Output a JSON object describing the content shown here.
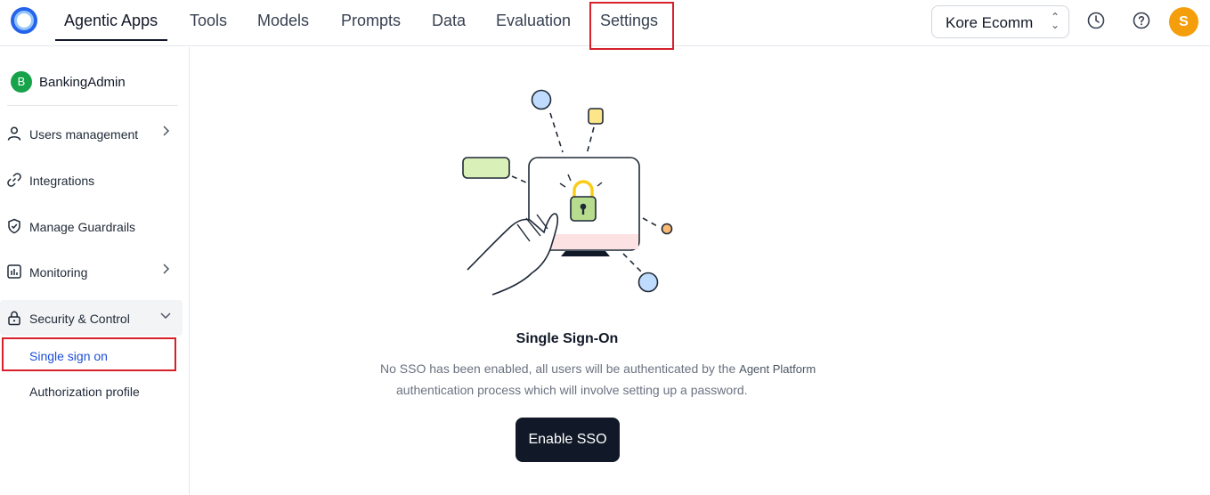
{
  "nav": {
    "tabs": [
      {
        "label": "Agentic Apps",
        "active": true
      },
      {
        "label": "Tools"
      },
      {
        "label": "Models"
      },
      {
        "label": "Prompts"
      },
      {
        "label": "Data"
      },
      {
        "label": "Evaluation"
      },
      {
        "label": "Settings",
        "highlighted": true
      }
    ],
    "workspace": "Kore Ecomm",
    "avatar_initial": "S"
  },
  "sidebar": {
    "org_initial": "B",
    "org_name": "BankingAdmin",
    "items": [
      {
        "label": "Users management",
        "icon": "user-icon",
        "has_chevron": true
      },
      {
        "label": "Integrations",
        "icon": "link-icon"
      },
      {
        "label": "Manage Guardrails",
        "icon": "shield-icon"
      },
      {
        "label": "Monitoring",
        "icon": "chart-icon",
        "has_chevron": true
      },
      {
        "label": "Security & Control",
        "icon": "lock-icon",
        "expanded": true
      }
    ],
    "sub_items": [
      {
        "label": "Single sign on",
        "active": true,
        "highlighted": true
      },
      {
        "label": "Authorization profile"
      }
    ]
  },
  "main": {
    "title": "Single Sign-On",
    "description_line1": "No SSO has been enabled, all users will be authenticated by the",
    "product_name": "Agent Platform",
    "description_line2": "authentication process which will involve setting up a password.",
    "cta_label": "Enable SSO"
  },
  "colors": {
    "accent": "#2563eb",
    "highlight_border": "#d6202b",
    "avatar": "#f59e0b",
    "org_badge": "#16a34a",
    "button_bg": "#111827"
  }
}
